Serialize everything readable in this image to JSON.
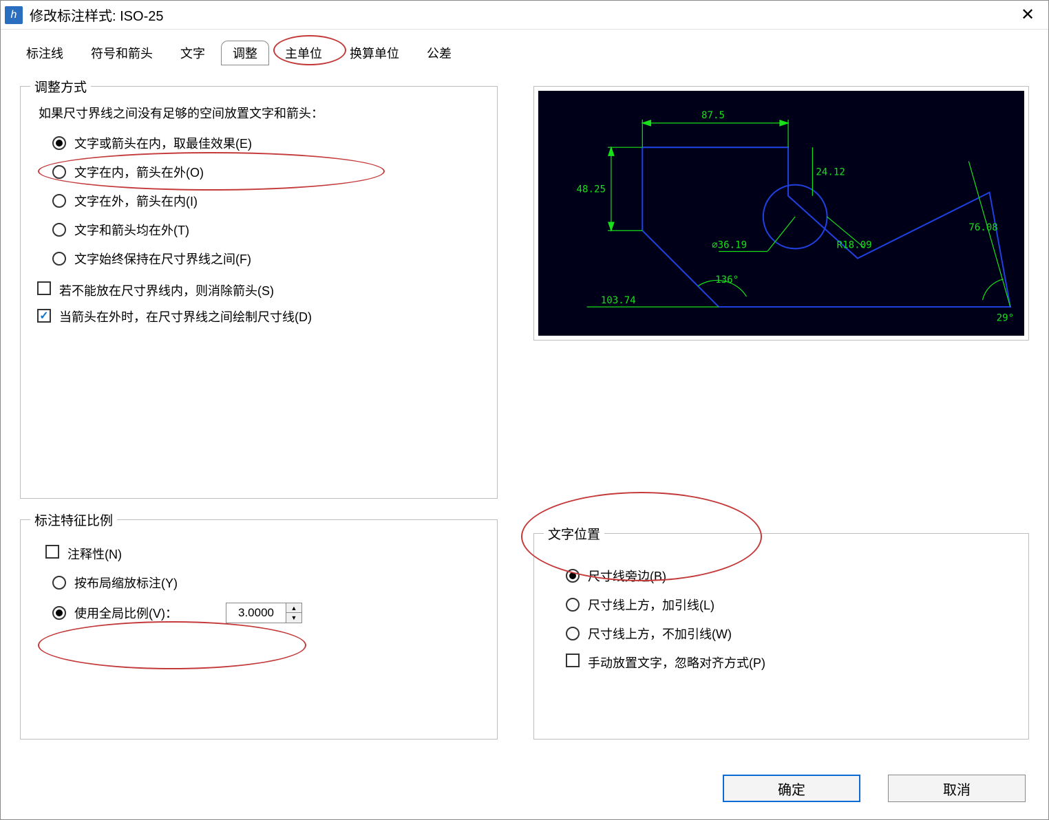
{
  "title": "修改标注样式: ISO-25",
  "tabs": {
    "dimlines": "标注线",
    "symbols": "符号和箭头",
    "text": "文字",
    "fit": "调整",
    "primary": "主单位",
    "alt": "换算单位",
    "tol": "公差"
  },
  "fit": {
    "group_title": "调整方式",
    "lead": "如果尺寸界线之间没有足够的空间放置文字和箭头：",
    "opt_best": "文字或箭头在内，取最佳效果(E)",
    "opt_textin": "文字在内，箭头在外(O)",
    "opt_textout": "文字在外，箭头在内(I)",
    "opt_both": "文字和箭头均在外(T)",
    "opt_keep": "文字始终保持在尺寸界线之间(F)",
    "chk_suppress": "若不能放在尺寸界线内，则消除箭头(S)",
    "chk_draw": "当箭头在外时，在尺寸界线之间绘制尺寸线(D)"
  },
  "scale": {
    "group_title": "标注特征比例",
    "chk_annot": "注释性(N)",
    "opt_layout": "按布局缩放标注(Y)",
    "opt_global": "使用全局比例(V)：",
    "value": "3.0000"
  },
  "textpos": {
    "group_title": "文字位置",
    "opt_beside": "尺寸线旁边(B)",
    "opt_above_leader": "尺寸线上方，加引线(L)",
    "opt_above_no": "尺寸线上方，不加引线(W)",
    "chk_manual": "手动放置文字，忽略对齐方式(P)"
  },
  "preview": {
    "d1": "87.5",
    "d2": "48.25",
    "d3": "24.12",
    "d4": "76.08",
    "dia": "⌀36.19",
    "rad": "R18.09",
    "len": "103.74",
    "ang1": "136°",
    "ang2": "29°"
  },
  "buttons": {
    "ok": "确定",
    "cancel": "取消"
  }
}
